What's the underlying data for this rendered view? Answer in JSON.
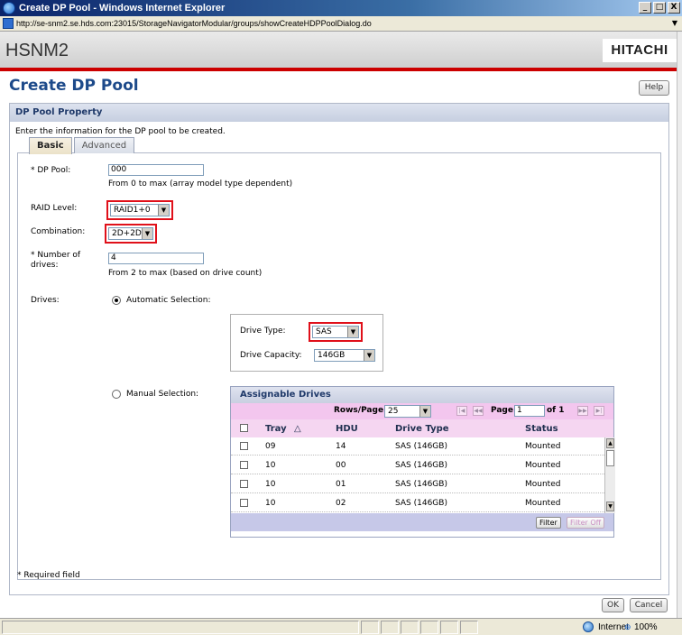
{
  "window": {
    "title": "Create DP Pool - Windows Internet Explorer",
    "minimize": "_",
    "maximize": "□",
    "close": "X"
  },
  "address": {
    "url": "http://se-snm2.se.hds.com:23015/StorageNavigatorModular/groups/showCreateHDPPoolDialog.do"
  },
  "app": {
    "name": "HSNM2",
    "brand": "HITACHI"
  },
  "page": {
    "title": "Create DP Pool",
    "help_label": "Help"
  },
  "section": {
    "title": "DP Pool Property",
    "description": "Enter the information for the DP pool to be created."
  },
  "tabs": [
    {
      "label": "Basic",
      "active": true
    },
    {
      "label": "Advanced",
      "active": false
    }
  ],
  "form": {
    "dp_pool": {
      "label": "* DP Pool:",
      "value": "000",
      "note": "From 0 to max (array model type dependent)"
    },
    "raid_level": {
      "label": "RAID Level:",
      "value": "RAID1+0"
    },
    "combination": {
      "label": "Combination:",
      "value": "2D+2D"
    },
    "num_drives": {
      "label_line1": "* Number of",
      "label_line2": "drives:",
      "value": "4",
      "note": "From 2 to max (based on drive count)"
    },
    "drives": {
      "label": "Drives:",
      "automatic": {
        "label": "Automatic Selection:",
        "selected": true,
        "drive_type_label": "Drive Type:",
        "drive_type_value": "SAS",
        "drive_capacity_label": "Drive Capacity:",
        "drive_capacity_value": "146GB"
      },
      "manual": {
        "label": "Manual Selection:",
        "selected": false
      }
    }
  },
  "assignable_drives": {
    "title": "Assignable Drives",
    "rows_per_page_label": "Rows/Page:",
    "rows_per_page_value": "25",
    "page_label": "Page",
    "page_value": "1",
    "of_label": "of 1",
    "columns": [
      "Tray",
      "HDU",
      "Drive Type",
      "Status"
    ],
    "sort_indicator": "△",
    "rows": [
      {
        "tray": "09",
        "hdu": "14",
        "drive_type": "SAS (146GB)",
        "status": "Mounted"
      },
      {
        "tray": "10",
        "hdu": "00",
        "drive_type": "SAS (146GB)",
        "status": "Mounted"
      },
      {
        "tray": "10",
        "hdu": "01",
        "drive_type": "SAS (146GB)",
        "status": "Mounted"
      },
      {
        "tray": "10",
        "hdu": "02",
        "drive_type": "SAS (146GB)",
        "status": "Mounted"
      }
    ],
    "filter_label": "Filter",
    "filter_off_label": "Filter Off"
  },
  "footer": {
    "required_note": "* Required field",
    "ok_label": "OK",
    "cancel_label": "Cancel"
  },
  "statusbar": {
    "zone": "Internet",
    "zoom": "100%"
  },
  "colors": {
    "highlight": "#e0101a",
    "brand_bar": "#cc0000",
    "title_blue": "#1d4a8a",
    "pager_pink": "#f3c6ee"
  }
}
